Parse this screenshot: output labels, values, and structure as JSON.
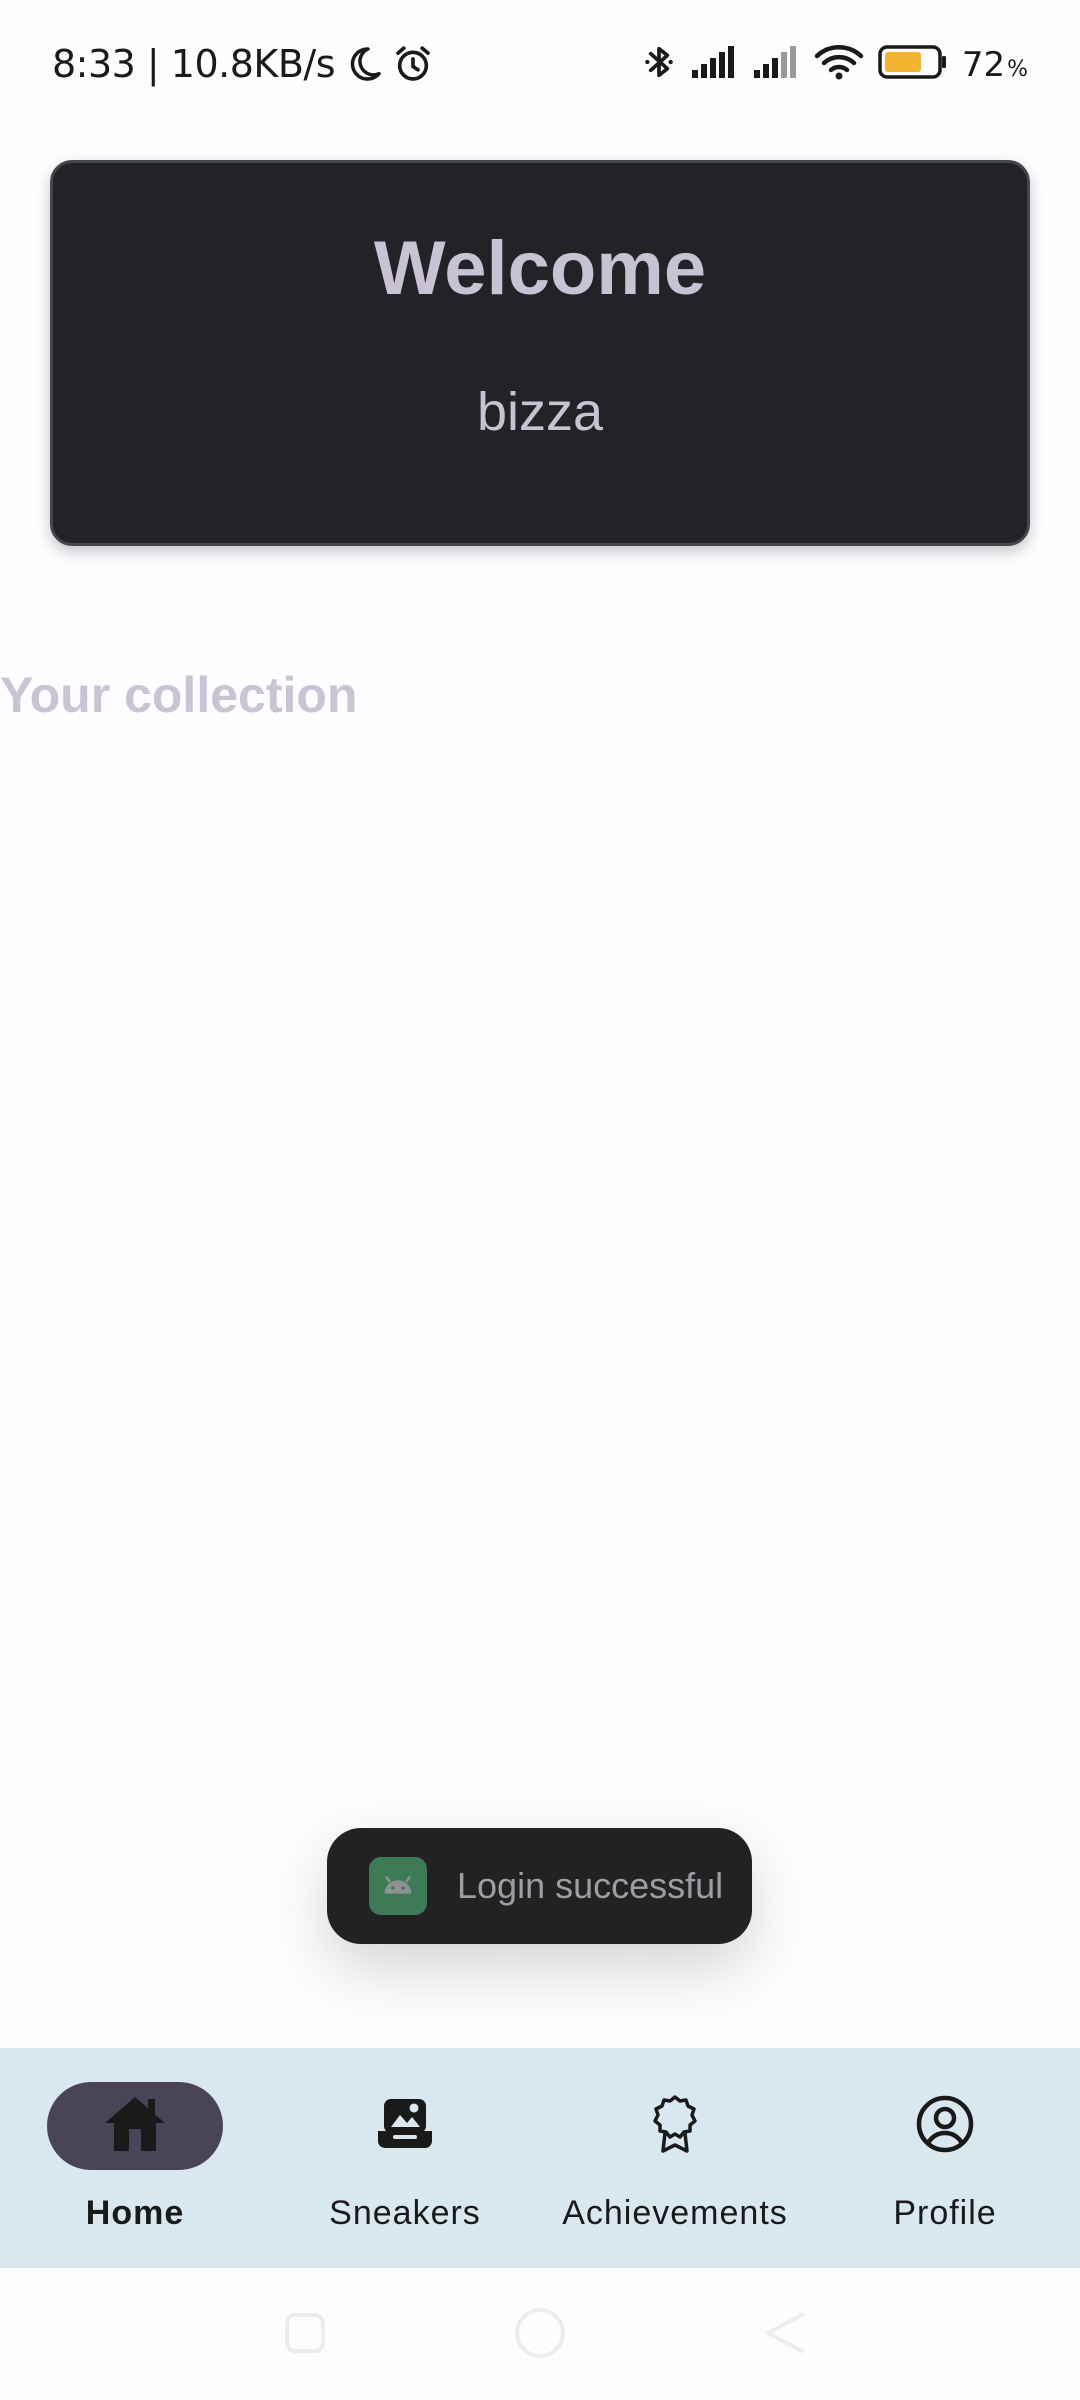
{
  "status_bar": {
    "time_speed": "8:33 | 10.8KB/s",
    "battery_percent": "72",
    "battery_unit": "%",
    "battery_level": 0.72,
    "battery_color": "#f2b531",
    "left_icons": [
      "moon-icon",
      "alarm-icon"
    ],
    "right_icons": [
      "bluetooth-icon",
      "signal-icon",
      "signal-icon",
      "wifi-icon",
      "battery-icon"
    ]
  },
  "welcome_card": {
    "title": "Welcome",
    "username": "bizza"
  },
  "collection": {
    "title": "Your collection"
  },
  "toast": {
    "icon": "android-icon",
    "message": "Login successful"
  },
  "bottom_nav": {
    "items": [
      {
        "label": "Home",
        "icon": "home-icon",
        "active": true
      },
      {
        "label": "Sneakers",
        "icon": "sneakers-box-icon",
        "active": false
      },
      {
        "label": "Achievements",
        "icon": "badge-icon",
        "active": false
      },
      {
        "label": "Profile",
        "icon": "account-circle-icon",
        "active": false
      }
    ]
  },
  "system_nav": {
    "buttons": [
      "recents-icon",
      "home-circle-icon",
      "back-icon"
    ]
  },
  "colors": {
    "background": "#fefcff",
    "card_background": "#222327",
    "card_text": "#c9c2d2",
    "nav_background": "#d8e8ee",
    "nav_active_pill": "#4a4459"
  }
}
